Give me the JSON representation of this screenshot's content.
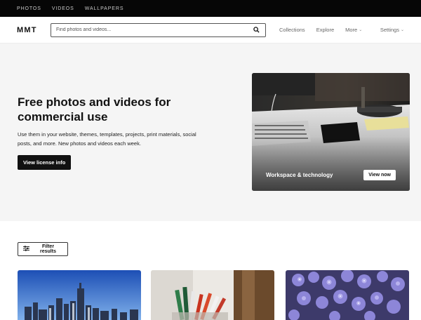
{
  "topbar": {
    "links": [
      "PHOTOS",
      "VIDEOS",
      "WALLPAPERS"
    ]
  },
  "header": {
    "logo": "MMT",
    "search_placeholder": "Find photos and videos...",
    "nav": {
      "collections": "Collections",
      "explore": "Explore",
      "more": "More",
      "settings": "Settings"
    }
  },
  "hero": {
    "title_line1": "Free photos and videos for",
    "title_line2": "commercial use",
    "subtitle": "Use them in your website, themes, templates, projects, print materials, social posts, and more. New photos and videos each week.",
    "license_button": "View license info",
    "card": {
      "caption": "Workspace & technology",
      "view_button": "View now"
    }
  },
  "filter": {
    "label": "Filter results"
  },
  "colors": {
    "topbar_bg": "#060606",
    "hero_bg": "#f5f5f5",
    "accent_dark": "#111111"
  },
  "grid": {
    "thumbnails": [
      "city-skyline-icon",
      "desk-supplies-icon",
      "purple-flowers-icon"
    ]
  }
}
